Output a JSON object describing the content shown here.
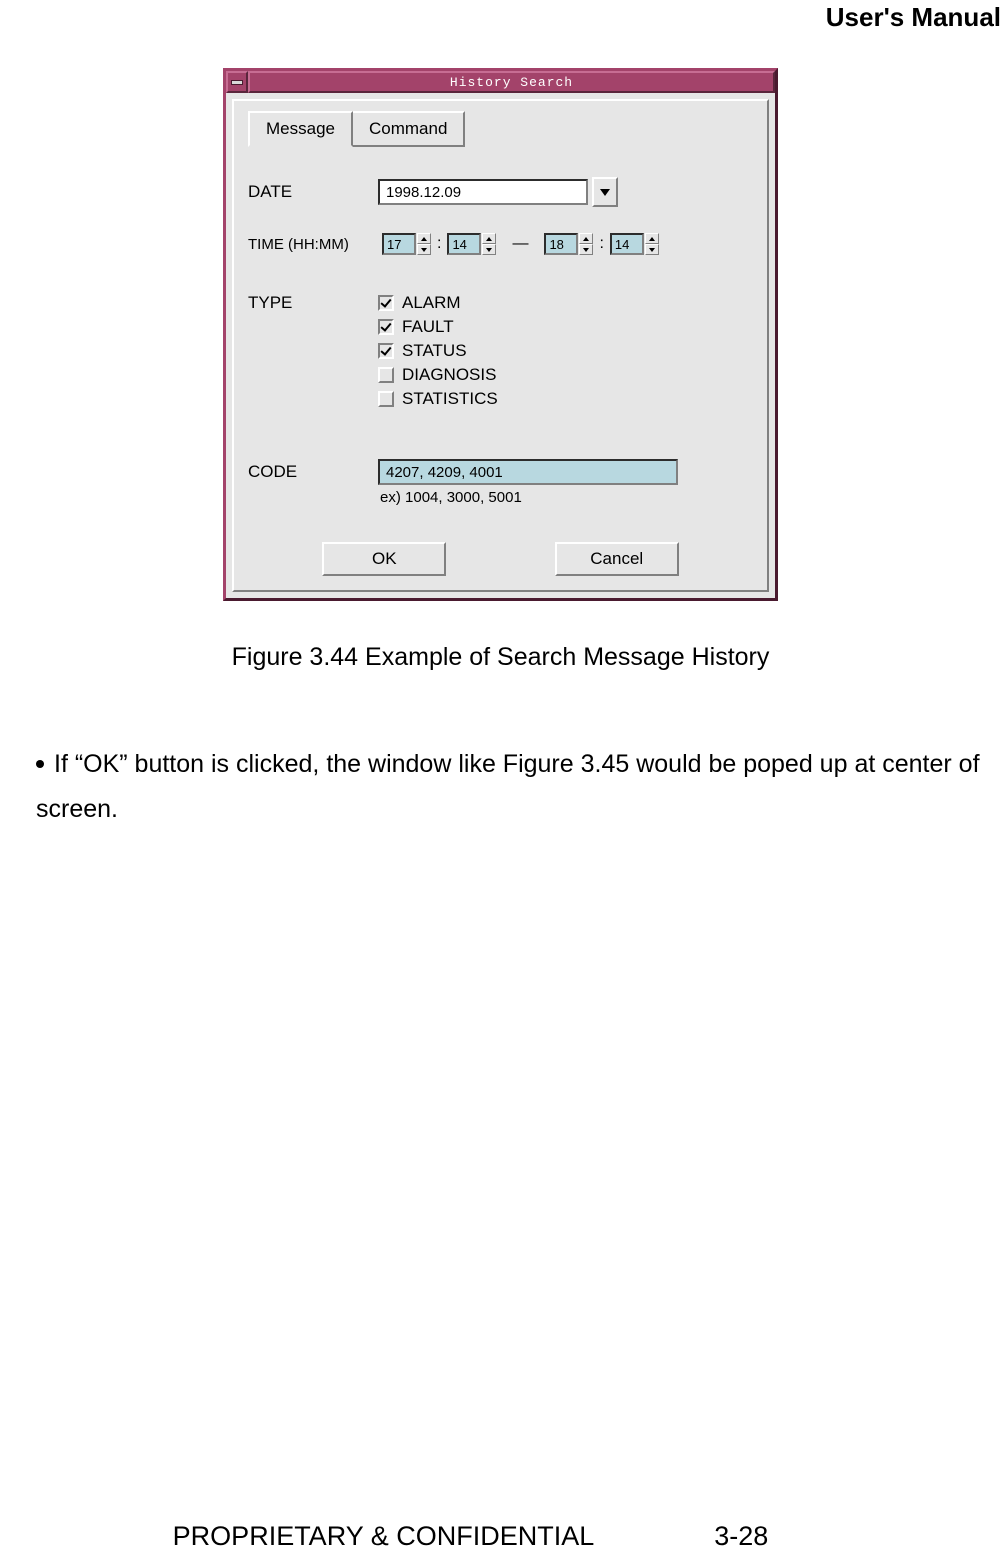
{
  "doc": {
    "header": "User's Manual",
    "caption": "Figure 3.44 Example of Search Message History",
    "body": "If “OK” button is clicked, the window like Figure 3.45 would be poped up at center of screen.",
    "footer_left": "PROPRIETARY & CONFIDENTIAL",
    "footer_right": "3-28"
  },
  "dialog": {
    "title": "History Search",
    "tabs": {
      "message": "Message",
      "command": "Command"
    },
    "labels": {
      "date": "DATE",
      "time": "TIME (HH:MM)",
      "type": "TYPE",
      "code": "CODE"
    },
    "date_value": "1998.12.09",
    "time": {
      "from_hh": "17",
      "from_mm": "14",
      "dash": "—",
      "to_hh": "18",
      "to_mm": "14"
    },
    "types": [
      {
        "label": "ALARM",
        "checked": true
      },
      {
        "label": "FAULT",
        "checked": true
      },
      {
        "label": "STATUS",
        "checked": true
      },
      {
        "label": "DIAGNOSIS",
        "checked": false
      },
      {
        "label": "STATISTICS",
        "checked": false
      }
    ],
    "code_value": "4207, 4209, 4001",
    "code_example": "ex) 1004, 3000, 5001",
    "buttons": {
      "ok": "OK",
      "cancel": "Cancel"
    }
  }
}
